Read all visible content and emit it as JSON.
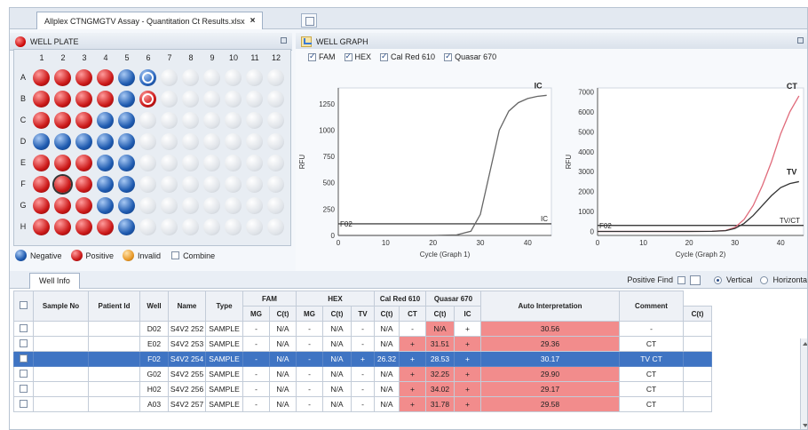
{
  "tabs": {
    "document": "Allplex CTNGMGTV Assay - Quantitation Ct Results.xlsx",
    "close": "×"
  },
  "well_plate": {
    "title": "WELL PLATE",
    "columns": [
      "1",
      "2",
      "3",
      "4",
      "5",
      "6",
      "7",
      "8",
      "9",
      "10",
      "11",
      "12"
    ],
    "rows": [
      "A",
      "B",
      "C",
      "D",
      "E",
      "F",
      "G",
      "H"
    ],
    "wells": [
      [
        "pos",
        "pos",
        "pos",
        "pos",
        "neg",
        "inv",
        "emp",
        "emp",
        "emp",
        "emp",
        "emp",
        "emp"
      ],
      [
        "pos",
        "pos",
        "pos",
        "pos",
        "neg",
        "inv",
        "emp",
        "emp",
        "emp",
        "emp",
        "emp",
        "emp"
      ],
      [
        "pos",
        "pos",
        "pos",
        "neg",
        "neg",
        "emp",
        "emp",
        "emp",
        "emp",
        "emp",
        "emp",
        "emp"
      ],
      [
        "neg",
        "neg",
        "neg",
        "neg",
        "neg",
        "emp",
        "emp",
        "emp",
        "emp",
        "emp",
        "emp",
        "emp"
      ],
      [
        "pos",
        "pos",
        "pos",
        "neg",
        "neg",
        "emp",
        "emp",
        "emp",
        "emp",
        "emp",
        "emp",
        "emp"
      ],
      [
        "pos",
        "pos",
        "pos",
        "neg",
        "neg",
        "emp",
        "emp",
        "emp",
        "emp",
        "emp",
        "emp",
        "emp"
      ],
      [
        "pos",
        "pos",
        "pos",
        "neg",
        "neg",
        "emp",
        "emp",
        "emp",
        "emp",
        "emp",
        "emp",
        "emp"
      ],
      [
        "pos",
        "pos",
        "pos",
        "pos",
        "neg",
        "emp",
        "emp",
        "emp",
        "emp",
        "emp",
        "emp",
        "emp"
      ]
    ],
    "selected_well": "F02",
    "legend": {
      "negative": "Negative",
      "positive": "Positive",
      "invalid": "Invalid",
      "combine": "Combine"
    }
  },
  "well_graph": {
    "title": "WELL GRAPH",
    "series": [
      {
        "label": "FAM",
        "checked": true
      },
      {
        "label": "HEX",
        "checked": true
      },
      {
        "label": "Cal Red 610",
        "checked": true
      },
      {
        "label": "Quasar 670",
        "checked": true
      }
    ]
  },
  "chart_data": [
    {
      "type": "line",
      "xlabel": "Cycle (Graph 1)",
      "ylabel": "RFU",
      "xlim": [
        0,
        45
      ],
      "ylim": [
        0,
        1400
      ],
      "xticks": [
        0,
        10,
        20,
        30,
        40
      ],
      "yticks": [
        0,
        250,
        500,
        750,
        1000,
        1250
      ],
      "series": [
        {
          "name": "IC",
          "color": "#666666",
          "x": [
            0,
            10,
            20,
            25,
            28,
            30,
            32,
            34,
            36,
            38,
            40,
            42,
            44
          ],
          "y": [
            0,
            0,
            0,
            5,
            40,
            200,
            600,
            1000,
            1180,
            1260,
            1300,
            1320,
            1330
          ]
        }
      ],
      "threshold": {
        "value": 110,
        "label": "IC"
      },
      "annotations": [
        "F02",
        "IC"
      ]
    },
    {
      "type": "line",
      "xlabel": "Cycle (Graph 2)",
      "ylabel": "RFU",
      "xlim": [
        0,
        45
      ],
      "ylim": [
        -200,
        7200
      ],
      "xticks": [
        0,
        10,
        20,
        30,
        40
      ],
      "yticks": [
        0,
        1000,
        2000,
        3000,
        4000,
        5000,
        6000,
        7000
      ],
      "series": [
        {
          "name": "CT",
          "color": "#e06a7a",
          "x": [
            0,
            10,
            20,
            25,
            28,
            30,
            32,
            34,
            36,
            38,
            40,
            42,
            44
          ],
          "y": [
            0,
            0,
            0,
            5,
            50,
            200,
            600,
            1300,
            2300,
            3500,
            4900,
            6000,
            6800
          ]
        },
        {
          "name": "TV",
          "color": "#333333",
          "x": [
            0,
            10,
            20,
            25,
            28,
            30,
            32,
            34,
            36,
            38,
            40,
            42,
            44
          ],
          "y": [
            0,
            0,
            0,
            5,
            40,
            150,
            400,
            800,
            1300,
            1800,
            2200,
            2400,
            2500
          ]
        }
      ],
      "threshold": {
        "value": 300,
        "label": "TV/CT"
      },
      "annotations": [
        "F02",
        "CT",
        "TV",
        "TV/CT"
      ]
    }
  ],
  "options": {
    "positive_find": "Positive Find",
    "vertical": "Vertical",
    "horizontal": "Horizonta"
  },
  "well_info": {
    "tab": "Well Info",
    "header_top": [
      "Sample No",
      "Patient Id",
      "Well",
      "Name",
      "Type",
      "FAM",
      "HEX",
      "Cal Red 610",
      "Quasar 670",
      "Auto Interpretation",
      "Comment"
    ],
    "header_sub": [
      "MG",
      "C(t)",
      "MG",
      "C(t)",
      "TV",
      "C(t)",
      "CT",
      "C(t)",
      "IC",
      "C(t)"
    ],
    "rows": [
      [
        "",
        "",
        "D02",
        "S4V2 252",
        "SAMPLE",
        "-",
        "N/A",
        "-",
        "N/A",
        "-",
        "N/A",
        "-",
        "N/A",
        "+",
        "30.56",
        "-",
        ""
      ],
      [
        "",
        "",
        "E02",
        "S4V2 253",
        "SAMPLE",
        "-",
        "N/A",
        "-",
        "N/A",
        "-",
        "N/A",
        "+",
        "31.51",
        "+",
        "29.36",
        "CT",
        ""
      ],
      [
        "",
        "",
        "F02",
        "S4V2 254",
        "SAMPLE",
        "-",
        "N/A",
        "-",
        "N/A",
        "+",
        "26.32",
        "+",
        "28.53",
        "+",
        "30.17",
        "TV CT",
        ""
      ],
      [
        "",
        "",
        "G02",
        "S4V2 255",
        "SAMPLE",
        "-",
        "N/A",
        "-",
        "N/A",
        "-",
        "N/A",
        "+",
        "32.25",
        "+",
        "29.90",
        "CT",
        ""
      ],
      [
        "",
        "",
        "H02",
        "S4V2 256",
        "SAMPLE",
        "-",
        "N/A",
        "-",
        "N/A",
        "-",
        "N/A",
        "+",
        "34.02",
        "+",
        "29.17",
        "CT",
        ""
      ],
      [
        "",
        "",
        "A03",
        "S4V2 257",
        "SAMPLE",
        "-",
        "N/A",
        "-",
        "N/A",
        "-",
        "N/A",
        "+",
        "31.78",
        "+",
        "29.58",
        "CT",
        ""
      ]
    ],
    "red_cells": [
      [
        12,
        14
      ],
      [
        11,
        12,
        13,
        14
      ],
      [
        9,
        10,
        11,
        12,
        13,
        14
      ],
      [
        11,
        12,
        13,
        14
      ],
      [
        11,
        12,
        13,
        14
      ],
      [
        11,
        12,
        13,
        14
      ]
    ],
    "selected_row": 2
  }
}
